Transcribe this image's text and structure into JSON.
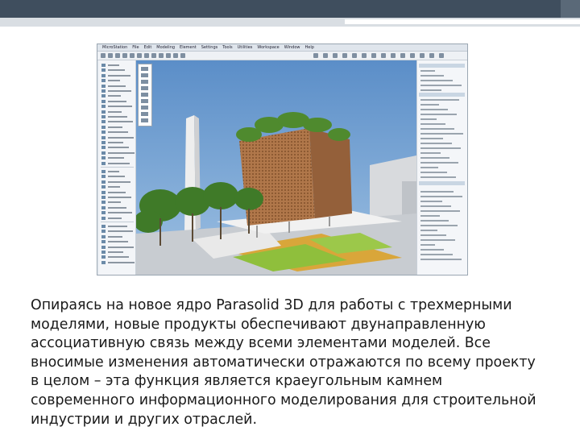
{
  "slide": {
    "caption": " Опираясь на новое ядро Parasolid 3D для работы с трехмерными\nмоделями, новые продукты обеспечивают двунаправленную\nассоциативную связь между всеми элементами моделей. Все\nвносимые изменения автоматически отражаются по всему проекту\nв целом – эта функция является краеугольным камнем\nсовременного информационного моделирования для строительной\nиндустрии и других отраслей."
  },
  "screenshot": {
    "menu_items": [
      "MicroStation",
      "File",
      "Edit",
      "Modeling",
      "Element",
      "Settings",
      "Tools",
      "Utilities",
      "Workspace",
      "Window",
      "Help"
    ],
    "scene": "architectural-building-3d-render",
    "colors": {
      "sky": "#6c9ccf",
      "ground": "#c9cdd1",
      "lawn": "#8fbf3c",
      "plaza": "#d9a63a",
      "facade": "#a86f3e",
      "tree": "#4f8a2e",
      "tower": "#e4e4e4"
    }
  }
}
